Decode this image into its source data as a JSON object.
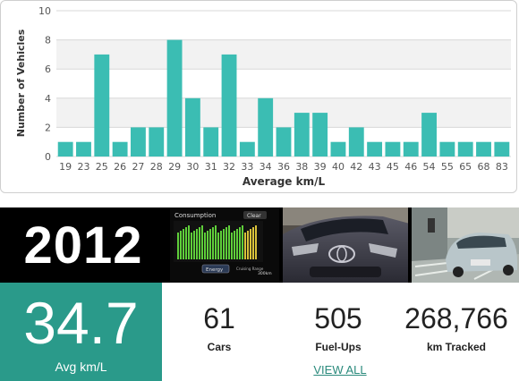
{
  "chart_data": {
    "type": "bar",
    "categories": [
      "19",
      "23",
      "25",
      "26",
      "27",
      "28",
      "29",
      "30",
      "31",
      "32",
      "33",
      "34",
      "36",
      "38",
      "39",
      "40",
      "42",
      "43",
      "45",
      "46",
      "54",
      "55",
      "65",
      "68",
      "83"
    ],
    "values": [
      1,
      1,
      7,
      1,
      2,
      2,
      8,
      4,
      2,
      7,
      1,
      4,
      2,
      3,
      3,
      1,
      2,
      1,
      1,
      1,
      3,
      1,
      1,
      1,
      1
    ],
    "xlabel": "Average km/L",
    "ylabel": "Number of Vehicles",
    "ylim": [
      0,
      10
    ],
    "yticks": [
      0,
      2,
      4,
      6,
      8,
      10
    ],
    "grid": true,
    "color": "#3bbdb3"
  },
  "stats": {
    "year": "2012",
    "avg_kmpl": "34.7",
    "avg_kmpl_label": "Avg km/L",
    "cars": "61",
    "cars_label": "Cars",
    "fuelups": "505",
    "fuelups_label": "Fuel-Ups",
    "km": "268,766",
    "km_label": "km Tracked",
    "view_all": "VIEW ALL"
  },
  "consumption_panel": {
    "title": "Consumption",
    "clear": "Clear",
    "energy": "Energy",
    "cruise": "Cruising Range",
    "range": "300km"
  },
  "colors": {
    "accent": "#2a9a8a",
    "bar": "#3bbdb3",
    "black": "#000000"
  }
}
